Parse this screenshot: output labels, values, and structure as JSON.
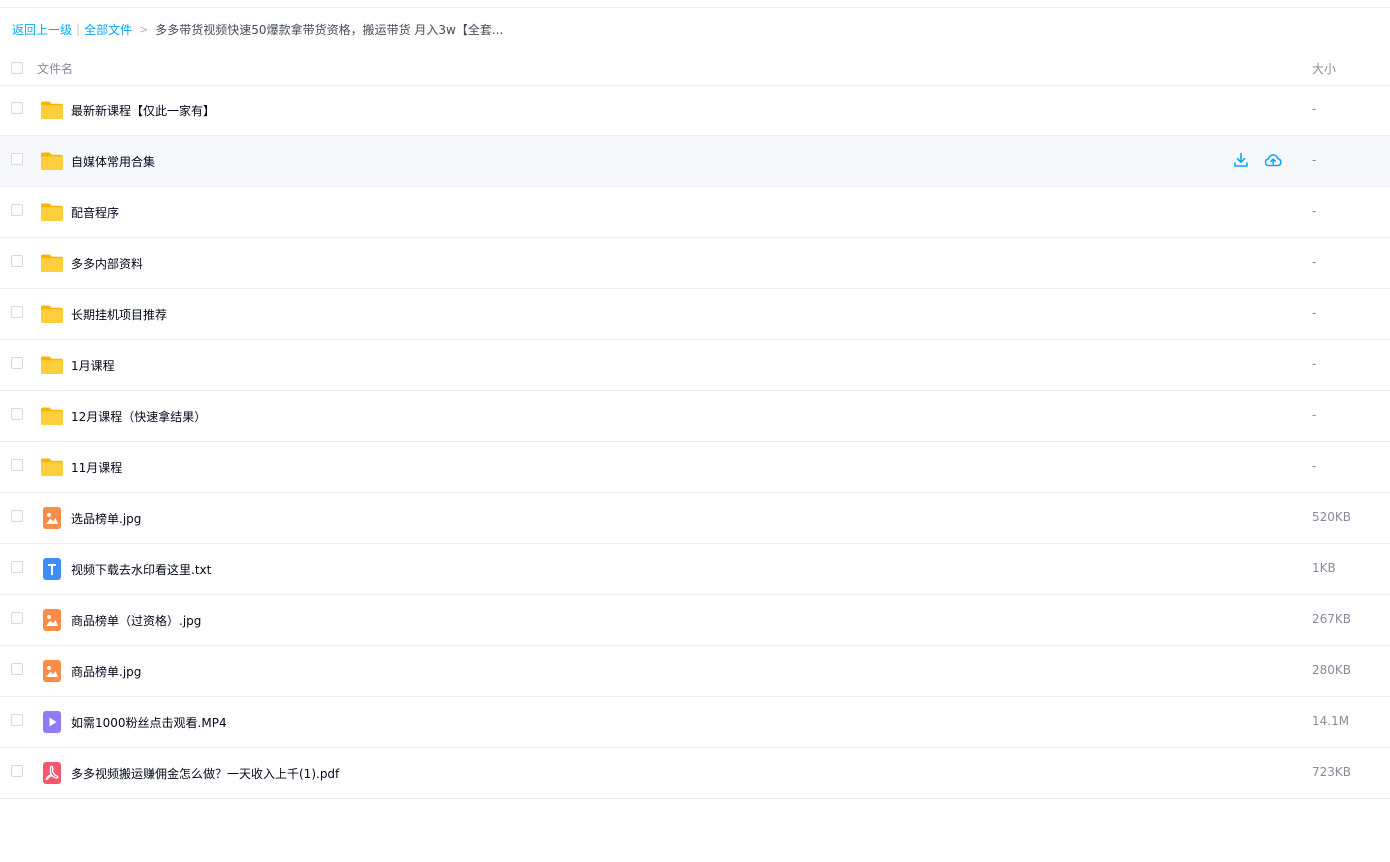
{
  "breadcrumb": {
    "back": "返回上一级",
    "separator": "|",
    "root": "全部文件",
    "arrow": ">",
    "current": "多多带货视频快速50爆款拿带货资格，搬运带货 月入3w【全套..."
  },
  "header": {
    "name": "文件名",
    "size": "大小"
  },
  "colors": {
    "accent": "#06a7ff",
    "folder": "#ffc933",
    "image": "#f98c48",
    "text": "#3d8ef8",
    "video": "#8f7bf7",
    "pdf": "#f4586a"
  },
  "files": [
    {
      "name": "最新新课程【仅此一家有】",
      "size": "-",
      "type": "folder"
    },
    {
      "name": "自媒体常用合集",
      "size": "-",
      "type": "folder"
    },
    {
      "name": "配音程序",
      "size": "-",
      "type": "folder"
    },
    {
      "name": "多多内部资料",
      "size": "-",
      "type": "folder"
    },
    {
      "name": "长期挂机项目推荐",
      "size": "-",
      "type": "folder"
    },
    {
      "name": "1月课程",
      "size": "-",
      "type": "folder"
    },
    {
      "name": "12月课程（快速拿结果）",
      "size": "-",
      "type": "folder"
    },
    {
      "name": "11月课程",
      "size": "-",
      "type": "folder"
    },
    {
      "name": "选品榜单.jpg",
      "size": "520KB",
      "type": "image"
    },
    {
      "name": "视频下载去水印看这里.txt",
      "size": "1KB",
      "type": "text"
    },
    {
      "name": "商品榜单（过资格）.jpg",
      "size": "267KB",
      "type": "image"
    },
    {
      "name": "商品榜单.jpg",
      "size": "280KB",
      "type": "image"
    },
    {
      "name": "如需1000粉丝点击观看.MP4",
      "size": "14.1M",
      "type": "video"
    },
    {
      "name": "多多视频搬运赚佣金怎么做？一天收入上千(1).pdf",
      "size": "723KB",
      "type": "pdf"
    }
  ]
}
